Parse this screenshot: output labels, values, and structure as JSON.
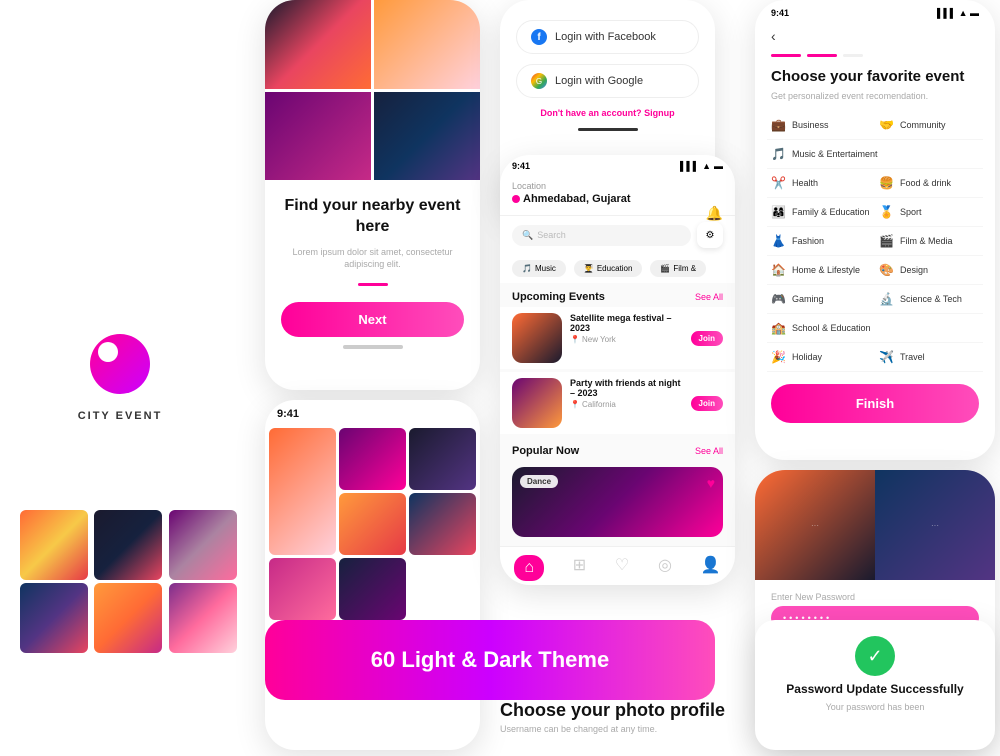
{
  "brand": {
    "name": "CITY EVENT",
    "tagline": "Find your nearby event here"
  },
  "onboard": {
    "heading": "Find your nearby event here",
    "subtext": "Lorem ipsum dolor sit amet, consectetur adipiscing elit.",
    "next_label": "Next"
  },
  "login": {
    "facebook_label": "Login with Facebook",
    "google_label": "Login with Google",
    "signup_text": "Don't have an account?",
    "signup_link": "Signup"
  },
  "app": {
    "time": "9:41",
    "location_label": "Location",
    "location_val": "Ahmedabad, Gujarat",
    "search_placeholder": "Search",
    "categories": [
      "Music",
      "Education",
      "Film &"
    ],
    "upcoming": "Upcoming Events",
    "see_all": "See All",
    "popular": "Popular Now",
    "events": [
      {
        "name": "Satellite mega festival – 2023",
        "location": "New York",
        "join": "Join"
      },
      {
        "name": "Party with friends at night – 2023",
        "location": "California",
        "join": "Join"
      }
    ],
    "dance_tag": "Dance"
  },
  "fav": {
    "back": "‹",
    "title": "Choose your favorite event",
    "subtitle": "Get personalized event recomendation.",
    "categories": [
      {
        "emoji": "💼",
        "label": "Business"
      },
      {
        "emoji": "🤝",
        "label": "Community"
      },
      {
        "emoji": "🎵",
        "label": "Music & Entertaiment"
      },
      {
        "emoji": "✂️",
        "label": "Health"
      },
      {
        "emoji": "🍔",
        "label": "Food & drink"
      },
      {
        "emoji": "👨‍👩‍👧",
        "label": "Family & Education"
      },
      {
        "emoji": "🏅",
        "label": "Sport"
      },
      {
        "emoji": "👗",
        "label": "Fashion"
      },
      {
        "emoji": "🎬",
        "label": "Film & Media"
      },
      {
        "emoji": "🏠",
        "label": "Home & Lifestyle"
      },
      {
        "emoji": "🎨",
        "label": "Design"
      },
      {
        "emoji": "🎮",
        "label": "Gaming"
      },
      {
        "emoji": "🔬",
        "label": "Science & Tech"
      },
      {
        "emoji": "🏫",
        "label": "School & Education"
      },
      {
        "emoji": "🎉",
        "label": "Holiday"
      },
      {
        "emoji": "✈️",
        "label": "Travel"
      }
    ],
    "finish_label": "Finish"
  },
  "password": {
    "label": "Enter New Password",
    "note": "Username can be changed at any time."
  },
  "success": {
    "title": "Password Update Successfully",
    "sub": "Your password has been"
  },
  "banner": {
    "text": "60 Light & Dark Theme"
  },
  "photo_profile": {
    "title": "Choose your photo profile",
    "sub": "Username can be changed at any time."
  }
}
